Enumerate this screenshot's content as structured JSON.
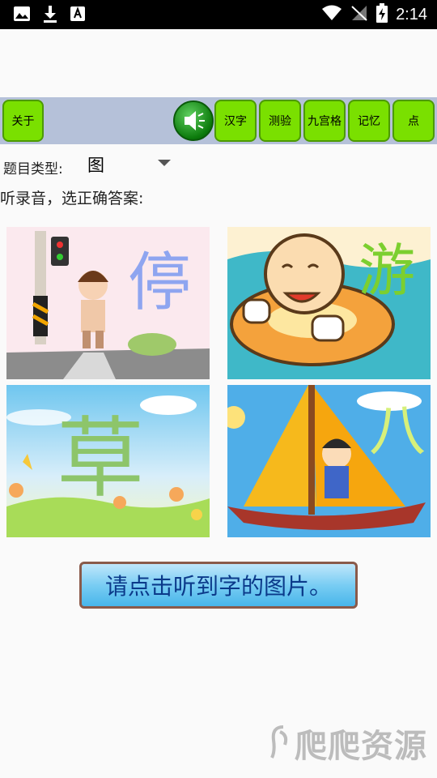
{
  "status_bar": {
    "time": "2:14"
  },
  "toolbar": {
    "about_label": "关于",
    "hanzi_label": "汉字",
    "test_label": "测验",
    "grid_label": "九宫格",
    "memory_label": "记忆",
    "dot_label": "点"
  },
  "question_type": {
    "label": "题目类型:",
    "value": "图"
  },
  "instruction": "听录音，选正确答案:",
  "options": [
    {
      "char": "停"
    },
    {
      "char": "游"
    },
    {
      "char": "草"
    },
    {
      "char": "八"
    }
  ],
  "prompt_button": "请点击听到字的图片。",
  "watermark": "爬爬资源"
}
